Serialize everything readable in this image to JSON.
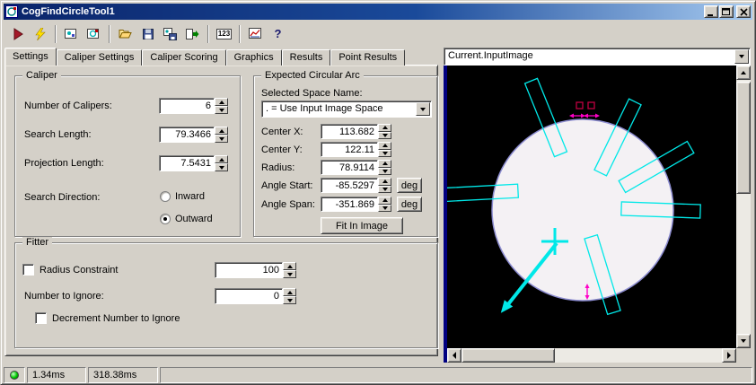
{
  "window": {
    "title": "CogFindCircleTool1"
  },
  "toolbar": {
    "numeric_button_label": "123",
    "help_label": "?"
  },
  "tabs": [
    "Settings",
    "Caliper Settings",
    "Caliper Scoring",
    "Graphics",
    "Results",
    "Point Results"
  ],
  "caliper": {
    "title": "Caliper",
    "number_label": "Number of Calipers:",
    "number_value": "6",
    "search_length_label": "Search Length:",
    "search_length_value": "79.3466",
    "projection_length_label": "Projection Length:",
    "projection_length_value": "7.5431",
    "direction_label": "Search Direction:",
    "inward_label": "Inward",
    "outward_label": "Outward"
  },
  "arc": {
    "title": "Expected Circular Arc",
    "space_label": "Selected Space Name:",
    "space_value": ". = Use Input Image Space",
    "center_x_label": "Center X:",
    "center_x_value": "113.682",
    "center_y_label": "Center Y:",
    "center_y_value": "122.11",
    "radius_label": "Radius:",
    "radius_value": "78.9114",
    "angle_start_label": "Angle Start:",
    "angle_start_value": "-85.5297",
    "angle_span_label": "Angle Span:",
    "angle_span_value": "-351.869",
    "deg_label": "deg",
    "fit_button_label": "Fit In Image"
  },
  "fitter": {
    "title": "Fitter",
    "radius_constraint_label": "Radius Constraint",
    "radius_constraint_value": "100",
    "ignore_label": "Number to Ignore:",
    "ignore_value": "0",
    "decrement_label": "Decrement Number to Ignore"
  },
  "image_panel": {
    "source": "Current.InputImage",
    "graphic_colors": {
      "caliper": "#00e8e8",
      "circle_stroke": "#8c8cd0",
      "marker": "#ff00c8",
      "handle": "#c00040"
    }
  },
  "status": {
    "time1": "1.34ms",
    "time2": "318.38ms"
  }
}
